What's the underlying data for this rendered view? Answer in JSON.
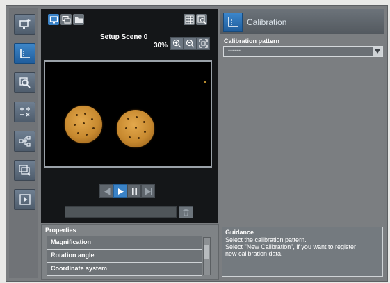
{
  "left_toolbar": {
    "tools": [
      {
        "name": "add-scene",
        "icon": "monitor-add-icon",
        "active": false
      },
      {
        "name": "calibration",
        "icon": "chart-axis-icon",
        "active": true
      },
      {
        "name": "inspect",
        "icon": "magnifier-icon",
        "active": false
      },
      {
        "name": "calculation",
        "icon": "arithmetic-icon",
        "active": false
      },
      {
        "name": "branch",
        "icon": "flow-branch-icon",
        "active": false
      },
      {
        "name": "image-search",
        "icon": "image-search-icon",
        "active": false
      },
      {
        "name": "output",
        "icon": "play-frame-icon",
        "active": false
      }
    ]
  },
  "center": {
    "scene_title": "Setup Scene 0",
    "zoom_level": "30%"
  },
  "properties": {
    "header": "Properties",
    "rows": [
      {
        "label": "Magnification",
        "value": ""
      },
      {
        "label": "Rotation angle",
        "value": ""
      },
      {
        "label": "Coordinate system",
        "value": ""
      }
    ]
  },
  "calibration": {
    "title": "Calibration",
    "pattern_label": "Calibration pattern",
    "pattern_value": "------"
  },
  "guidance": {
    "header": "Guidance",
    "lines": [
      "Select the calibration pattern.",
      "Select \"New Calibration\", if you want to register",
      "new calibration data."
    ]
  },
  "colors": {
    "accent": "#3a82c6",
    "panel_dark": "#141618",
    "frame": "#7a7d80"
  }
}
